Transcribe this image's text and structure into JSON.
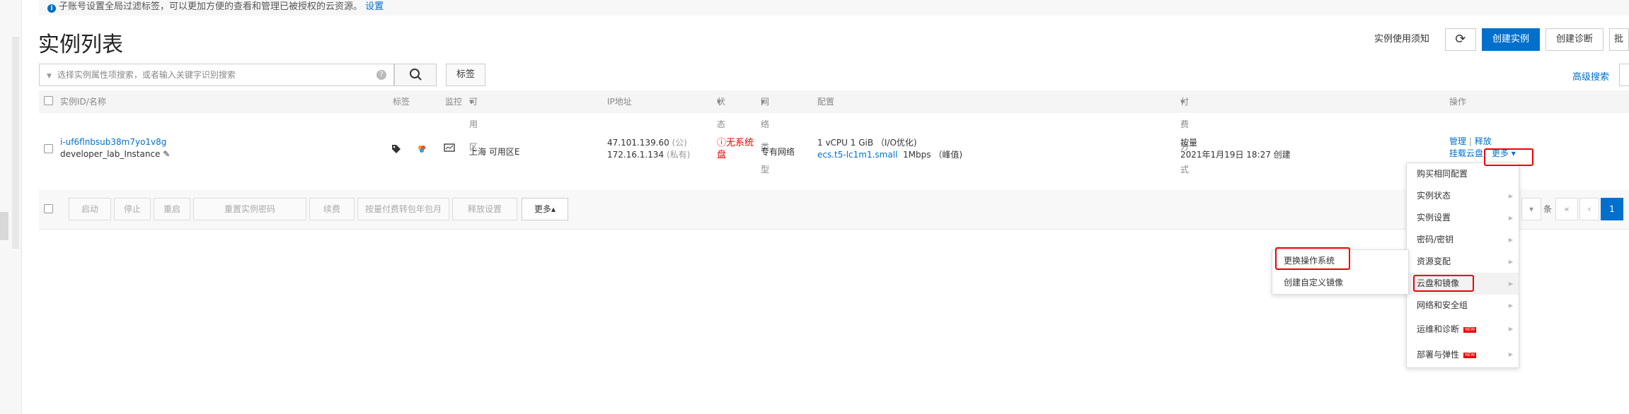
{
  "notice": {
    "text": "子账号设置全局过滤标签，可以更加方便的查看和管理已被授权的云资源。",
    "link": "设置"
  },
  "page_title": "实例列表",
  "top_actions": {
    "usage_notice": "实例使用须知",
    "refresh_icon": "refresh-icon",
    "create_instance": "创建实例",
    "create_diagnosis": "创建诊断",
    "truncated": "批"
  },
  "search": {
    "placeholder": "选择实例属性项搜索，或者输入关键字识别搜索",
    "help": "?",
    "tag_button": "标签",
    "advanced": "高级搜索"
  },
  "table": {
    "headers": {
      "id_name": "实例ID/名称",
      "tags": "标签",
      "monitor": "监控",
      "zone": "可用区",
      "ip": "IP地址",
      "status": "状态",
      "network": "网络类型",
      "config": "配置",
      "billing": "付费方式",
      "ops": "操作"
    },
    "row": {
      "id": "i-uf6flnbsub38m7yo1v8g",
      "name": "developer_lab_Instance",
      "zone": "上海 可用区E",
      "ip_public": "47.101.139.60",
      "ip_public_tag": "(公)",
      "ip_private": "172.16.1.134",
      "ip_private_tag": "(私有)",
      "status_line1": "无系统",
      "status_line2": "盘",
      "network": "专有网络",
      "config_line1": "1 vCPU 1 GiB （I/O优化)",
      "config_type": "ecs.t5-lc1m1.small",
      "config_bandwidth": "1Mbps （峰值)",
      "billing": "按量",
      "created": "2021年1月19日 18:27 创建",
      "op_manage": "管理",
      "op_sep": "|",
      "op_release": "释放",
      "op_mount": "挂载云盘",
      "op_more": "更多"
    }
  },
  "action_bar": [
    "启动",
    "停止",
    "重启",
    "重置实例密码",
    "续费",
    "按量付费转包年包月",
    "释放设置",
    "更多"
  ],
  "pagination": {
    "size_suffix": "条",
    "first": "«",
    "prev": "‹",
    "current": "1"
  },
  "more_menu": [
    {
      "label": "购买相同配置",
      "arrow": false,
      "new": false
    },
    {
      "label": "实例状态",
      "arrow": true,
      "new": false
    },
    {
      "label": "实例设置",
      "arrow": true,
      "new": false
    },
    {
      "label": "密码/密钥",
      "arrow": true,
      "new": false
    },
    {
      "label": "资源变配",
      "arrow": true,
      "new": false
    },
    {
      "label": "云盘和镜像",
      "arrow": true,
      "new": false
    },
    {
      "label": "网络和安全组",
      "arrow": true,
      "new": false
    },
    {
      "label": "运维和诊断",
      "arrow": true,
      "new": true
    },
    {
      "label": "部署与弹性",
      "arrow": true,
      "new": true
    }
  ],
  "submenu": [
    "更换操作系统",
    "创建自定义镜像"
  ],
  "new_badge": "NEW",
  "colors": {
    "primary": "#0070cc",
    "highlight_red": "#e00000"
  }
}
